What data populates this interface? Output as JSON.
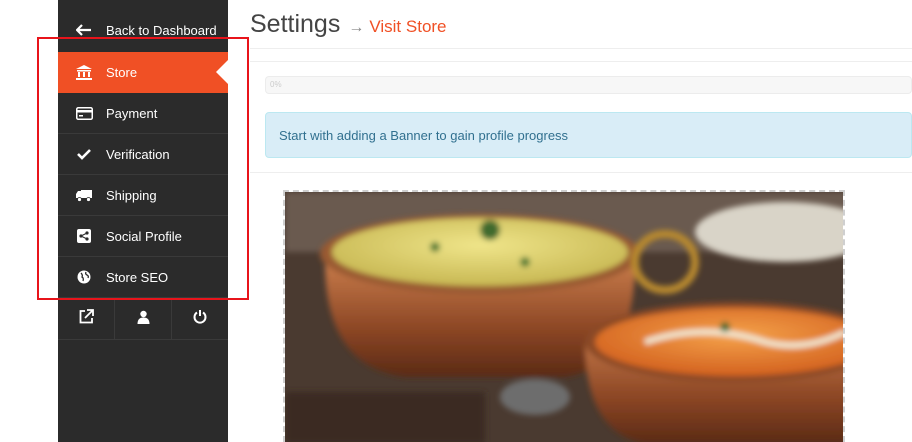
{
  "sidebar": {
    "back_label": "Back to Dashboard",
    "items": [
      {
        "label": "Store",
        "icon": "bank-icon",
        "active": true
      },
      {
        "label": "Payment",
        "icon": "credit-card-icon"
      },
      {
        "label": "Verification",
        "icon": "checkmark-icon"
      },
      {
        "label": "Shipping",
        "icon": "truck-icon"
      },
      {
        "label": "Social Profile",
        "icon": "share-icon"
      },
      {
        "label": "Store SEO",
        "icon": "globe-icon"
      }
    ],
    "bottom_icons": [
      "external-link-icon",
      "user-icon",
      "power-icon"
    ]
  },
  "header": {
    "title": "Settings",
    "arrow": "→",
    "link": "Visit Store"
  },
  "progress": {
    "value_percent": 0,
    "label": "0%"
  },
  "notice": {
    "text": "Start with adding a Banner to gain profile progress"
  },
  "colors": {
    "accent": "#f05025",
    "sidebar_bg": "#2b2b2b",
    "info_bg": "#d9edf7",
    "info_text": "#31708f",
    "annotation": "#e8141b"
  }
}
